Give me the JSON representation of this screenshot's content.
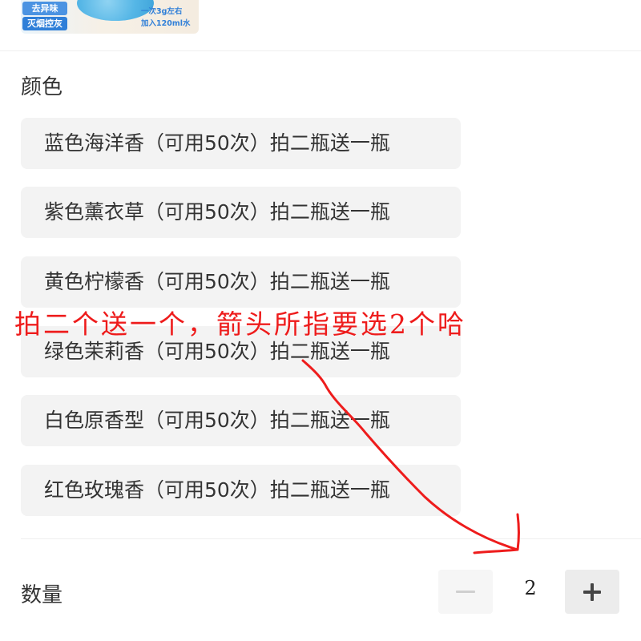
{
  "thumbnail": {
    "tag_top": "去异味",
    "tag_bottom": "灭烟控灰",
    "note_top": "一次3g左右",
    "note_bottom": "加入120ml水"
  },
  "color_section": {
    "label": "颜色",
    "options": [
      "蓝色海洋香（可用50次）拍二瓶送一瓶",
      "紫色薰衣草（可用50次）拍二瓶送一瓶",
      "黄色柠檬香（可用50次）拍二瓶送一瓶",
      "绿色茉莉香（可用50次）拍二瓶送一瓶",
      "白色原香型（可用50次）拍二瓶送一瓶",
      "红色玫瑰香（可用50次）拍二瓶送一瓶"
    ]
  },
  "quantity": {
    "label": "数量",
    "value": "2"
  },
  "annotation": {
    "text": "拍二个送一个，箭头所指要选2个哈",
    "color": "#ee1c1c"
  },
  "colors": {
    "option_bg": "#f3f3f3",
    "accent_blue": "#2f7fd8"
  },
  "icons": {
    "minus": "minus-icon",
    "plus": "plus-icon",
    "arrow": "hand-drawn-arrow-icon"
  }
}
